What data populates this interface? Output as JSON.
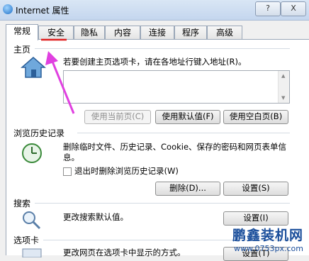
{
  "window": {
    "title": "Internet 属性",
    "help_label": "?",
    "close_label": "X"
  },
  "tabs": [
    {
      "label": "常规"
    },
    {
      "label": "安全"
    },
    {
      "label": "隐私"
    },
    {
      "label": "内容"
    },
    {
      "label": "连接"
    },
    {
      "label": "程序"
    },
    {
      "label": "高级"
    }
  ],
  "homepage": {
    "label": "主页",
    "desc": "若要创建主页选项卡，请在各地址行键入地址(R)。",
    "value": "",
    "use_current": "使用当前页(C)",
    "use_default": "使用默认值(F)",
    "use_blank": "使用空白页(B)"
  },
  "history": {
    "label": "浏览历史记录",
    "desc": "删除临时文件、历史记录、Cookie、保存的密码和网页表单信息。",
    "checkbox_label": "退出时删除浏览历史记录(W)",
    "delete_label": "删除(D)...",
    "settings_label": "设置(S)"
  },
  "search": {
    "label": "搜索",
    "desc": "更改搜索默认值。",
    "settings_label": "设置(I)"
  },
  "tabs_section": {
    "label": "选项卡",
    "desc": "更改网页在选项卡中显示的方式。",
    "settings_label": "设置(T)"
  },
  "watermark": {
    "name": "鹏鑫装机网",
    "url": "www.0753px.com"
  },
  "colors": {
    "annotation_arrow": "#e040e0",
    "annotation_underline": "#e02020",
    "watermark": "#1a4e9b"
  }
}
